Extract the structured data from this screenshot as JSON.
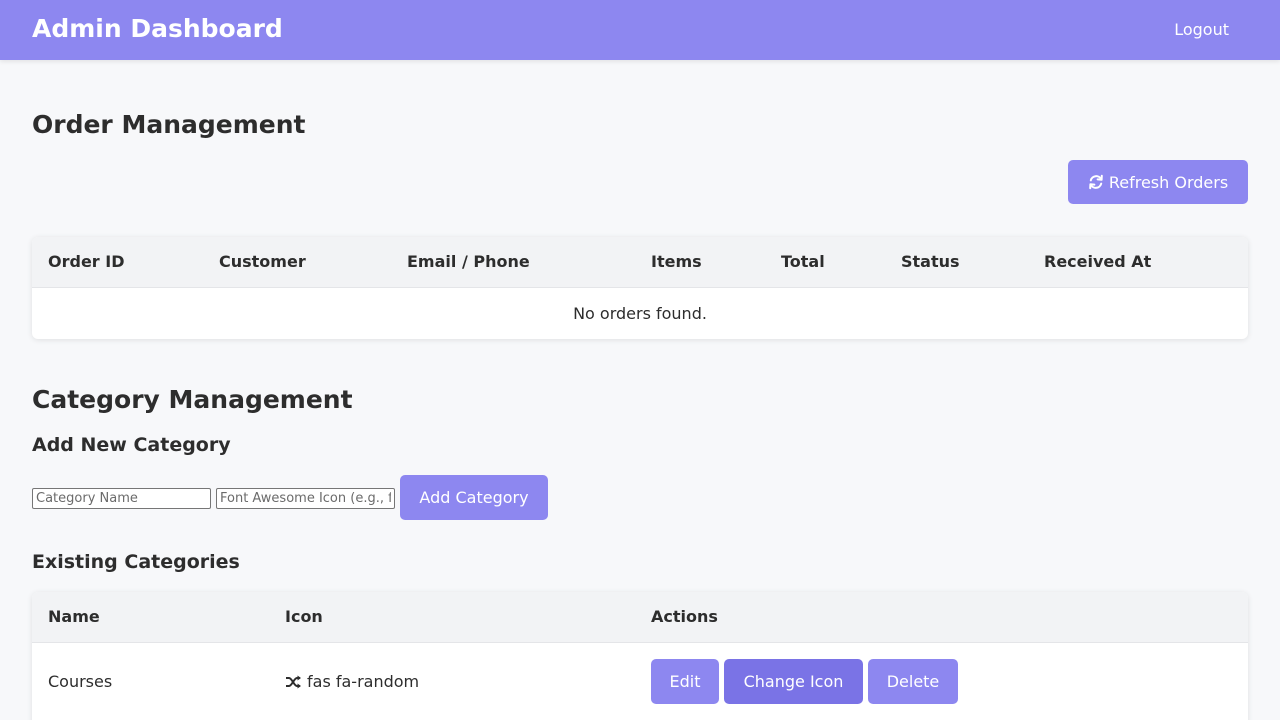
{
  "header": {
    "title": "Admin Dashboard",
    "logout_label": "Logout"
  },
  "orders": {
    "title": "Order Management",
    "refresh_label": "Refresh Orders",
    "refresh_icon": "sync-icon",
    "columns": [
      "Order ID",
      "Customer",
      "Email / Phone",
      "Items",
      "Total",
      "Status",
      "Received At"
    ],
    "empty_text": "No orders found."
  },
  "categories": {
    "title": "Category Management",
    "add_title": "Add New Category",
    "name_placeholder": "Category Name",
    "icon_placeholder": "Font Awesome Icon (e.g., fas fa-book)",
    "add_label": "Add Category",
    "existing_title": "Existing Categories",
    "columns": [
      "Name",
      "Icon",
      "Actions"
    ],
    "rows": [
      {
        "name": "Courses",
        "icon_class": "fas fa-random",
        "icon_name": "shuffle-icon",
        "actions": {
          "edit": "Edit",
          "change_icon": "Change Icon",
          "delete": "Delete"
        }
      }
    ]
  },
  "colors": {
    "accent": "#8d87f0",
    "accent_dark": "#7a73e6",
    "background": "#f7f8fa"
  }
}
